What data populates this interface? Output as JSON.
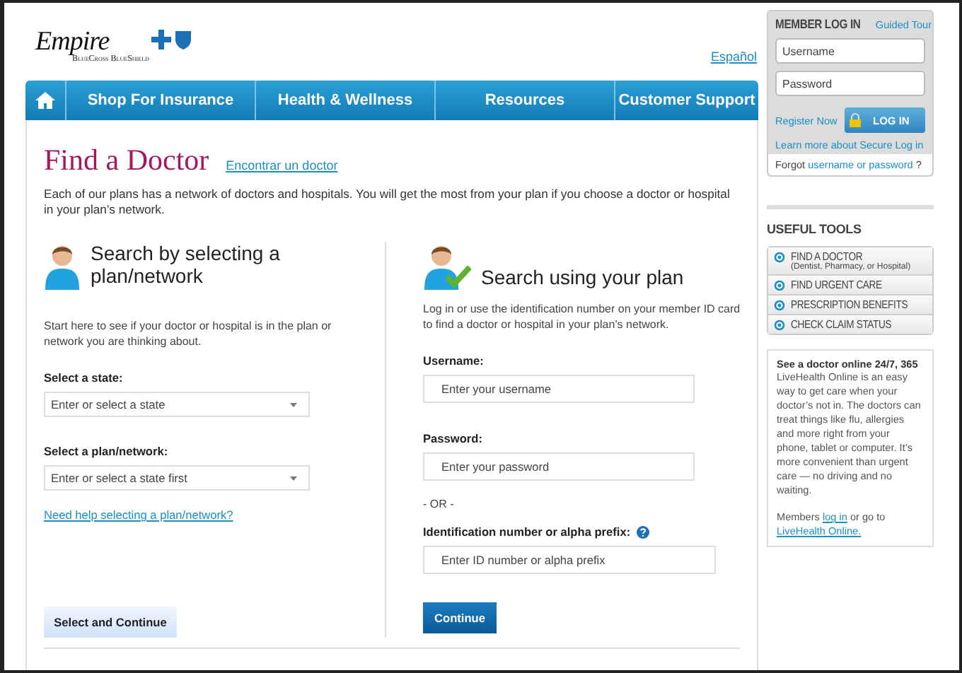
{
  "logo": {
    "name": "Empire",
    "tagline": "BlueCross BlueShield"
  },
  "language_link": "Español",
  "nav": [
    {
      "label": "Shop For Insurance"
    },
    {
      "label": "Health & Wellness"
    },
    {
      "label": "Resources"
    },
    {
      "label": "Customer Support"
    }
  ],
  "page": {
    "title": "Find a Doctor",
    "alt_link": "Encontrar un doctor",
    "intro": "Each of our plans has a network of doctors and hospitals. You will get the most from your plan if you choose a doctor or hospital in your plan’s network."
  },
  "plan_search": {
    "heading": "Search by selecting a plan/network",
    "description": "Start here to see if your doctor or hospital is in the plan or network you are thinking about.",
    "fields": [
      {
        "label": "Select a state:",
        "placeholder": "Enter or select a state"
      },
      {
        "label": "Select a plan/network:",
        "placeholder": "Enter or select a state first"
      }
    ],
    "help_link": "Need help selecting a plan/network?",
    "button": "Select and Continue"
  },
  "member_search": {
    "heading": "Search using your plan",
    "description": "Log in or use the identification number on your member ID card to find a doctor or hospital in your plan’s network.",
    "fields": [
      {
        "label": "Username:",
        "placeholder": "Enter your username",
        "help": false
      },
      {
        "label": "Password:",
        "placeholder": "Enter your password",
        "help": false,
        "separator": "- OR -"
      },
      {
        "label": "Identification number or alpha prefix:",
        "placeholder": "Enter ID number or alpha prefix",
        "help": true
      }
    ],
    "button": "Continue"
  },
  "login": {
    "title": "MEMBER LOG IN",
    "tour_link": "Guided Tour",
    "username_placeholder": "Username",
    "password_placeholder": "Password",
    "register_link": "Register Now",
    "login_button": "LOG IN",
    "learn_more_link": "Learn more about Secure Log in",
    "forgot_prefix": "Forgot",
    "forgot_link": "username or password",
    "forgot_suffix": "?"
  },
  "useful_tools": {
    "title": "USEFUL TOOLS",
    "items": [
      {
        "label": "FIND A DOCTOR",
        "sub": "(Dentist, Pharmacy, or Hospital)"
      },
      {
        "label": "FIND URGENT CARE"
      },
      {
        "label": "PRESCRIPTION BENEFITS"
      },
      {
        "label": "CHECK CLAIM STATUS"
      }
    ]
  },
  "promo": {
    "title": "See a doctor online 24/7, 365",
    "body": "LiveHealth Online is an easy way to get care when your doctor’s not in. The doctors can treat things like flu, allergies and more right from your phone, tablet or computer. It’s more convenient than urgent care — no driving and no waiting.",
    "members_prefix": "Members",
    "log_in_link": "log in",
    "members_middle": "or go to",
    "site_link": "LiveHealth Online."
  }
}
